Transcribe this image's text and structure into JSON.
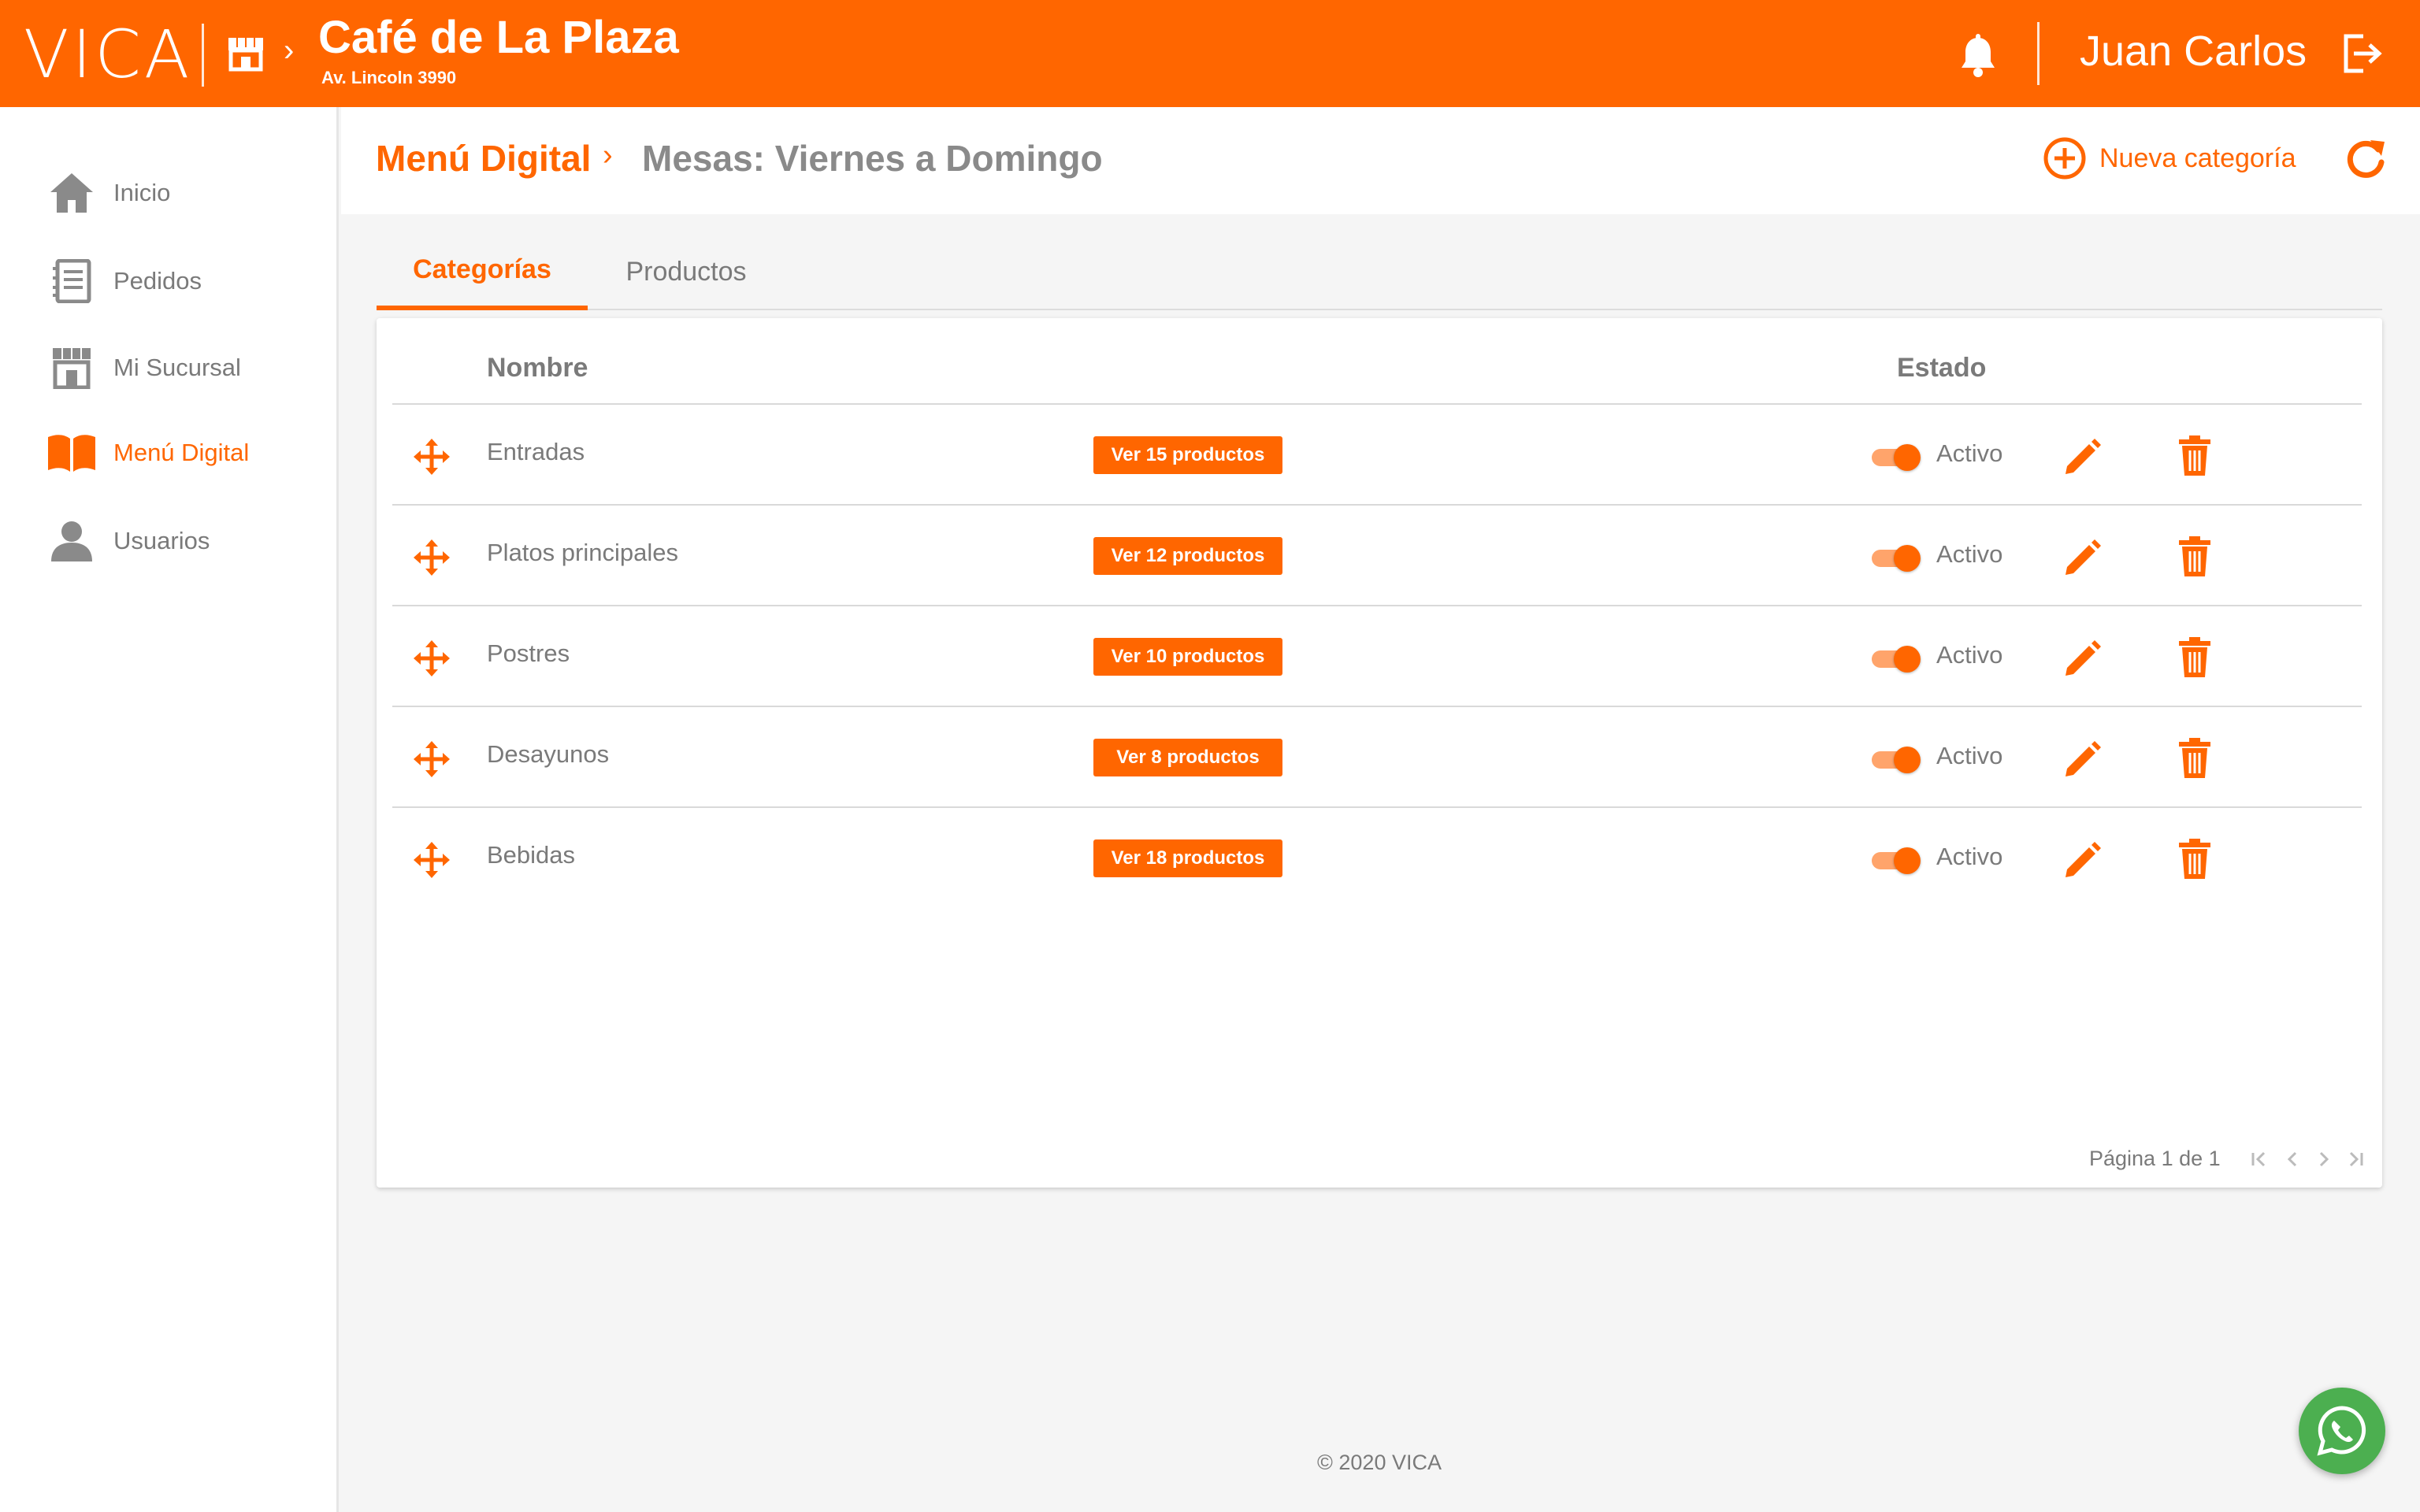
{
  "header": {
    "logo": "VICA",
    "business_name": "Café de La Plaza",
    "business_address": "Av. Lincoln 3990",
    "user_name": "Juan Carlos",
    "icons": [
      "store-icon",
      "bell-icon",
      "logout-icon"
    ]
  },
  "sidebar": {
    "items": [
      {
        "label": "Inicio",
        "icon": "home-icon"
      },
      {
        "label": "Pedidos",
        "icon": "orders-icon"
      },
      {
        "label": "Mi Sucursal",
        "icon": "store-icon"
      },
      {
        "label": "Menú Digital",
        "icon": "book-icon",
        "active": true
      },
      {
        "label": "Usuarios",
        "icon": "user-icon"
      }
    ]
  },
  "subheader": {
    "title": "Menú Digital",
    "subtitle": "Mesas: Viernes a Domingo",
    "new_category_label": "Nueva categoría"
  },
  "tabs": [
    {
      "label": "Categorías",
      "active": true
    },
    {
      "label": "Productos",
      "active": false
    }
  ],
  "table": {
    "headers": {
      "name": "Nombre",
      "status": "Estado"
    },
    "rows": [
      {
        "name": "Entradas",
        "products_button": "Ver 15 productos",
        "status": "Activo",
        "enabled": true
      },
      {
        "name": "Platos principales",
        "products_button": "Ver 12 productos",
        "status": "Activo",
        "enabled": true
      },
      {
        "name": "Postres",
        "products_button": "Ver 10 productos",
        "status": "Activo",
        "enabled": true
      },
      {
        "name": "Desayunos",
        "products_button": "Ver 8 productos",
        "status": "Activo",
        "enabled": true
      },
      {
        "name": "Bebidas",
        "products_button": "Ver 18 productos",
        "status": "Activo",
        "enabled": true
      }
    ],
    "pagination": "Página 1 de 1"
  },
  "footer": "© 2020 VICA",
  "colors": {
    "accent": "#ff6600",
    "text": "#7a7a7a",
    "whatsapp": "#4caf50"
  }
}
